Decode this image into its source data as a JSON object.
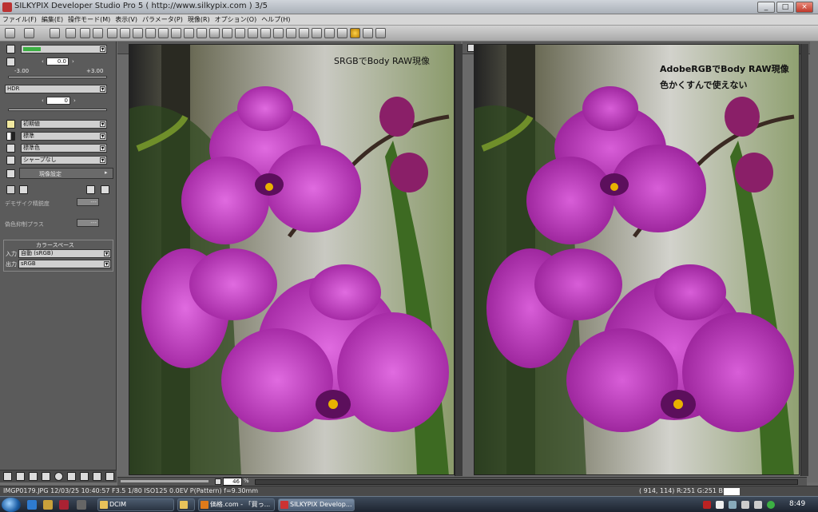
{
  "window": {
    "title": "SILKYPIX Developer Studio Pro 5 ( http://www.silkypix.com )   3/5",
    "buttons": [
      "_",
      "□",
      "×"
    ]
  },
  "menu": [
    "ファイル(F)",
    "編集(E)",
    "操作モード(M)",
    "表示(V)",
    "パラメータ(P)",
    "現像(R)",
    "オプション(O)",
    "ヘルプ(H)"
  ],
  "left": {
    "exposure_value": "0.0",
    "exposure_min": "-3.00",
    "exposure_max": "+3.00",
    "hdr_label": "HDR",
    "hdr_value": "0",
    "presets": [
      "初期値",
      "標準",
      "標準色",
      "シャープなし"
    ],
    "dev_settings_label": "現像設定",
    "demosaic_label": "デモザイク精鋭度",
    "demosaic_value": "---",
    "false_color_label": "偽色抑制プラス",
    "false_color_value": "---",
    "colorspace_header": "カラースペース",
    "input_label": "入力",
    "input_value": "自動 (sRGB)",
    "output_label": "出力",
    "output_value": "sRGB"
  },
  "viewer": {
    "left_caption": "SRGBでBody RAW現像",
    "right_caption_1": "AdobeRGBでBody RAW現像",
    "right_caption_2": "色かくすんで使えない",
    "zoom": "46"
  },
  "status": {
    "left": "IMGP0179.JPG 12/03/25 10:40:57 F3.5 1/80 ISO125  0.0EV P(Pattern) f=9.30mm",
    "right": "( 914, 114) R:251 G:251 B:251"
  },
  "taskbar": {
    "items": [
      "DCIM",
      "",
      "価格.com - 「買っ...",
      "SILKYPIX Develop..."
    ],
    "time": "8:49"
  },
  "colors": {
    "accent_green": "#3cb043",
    "panel": "#5b5b5b"
  }
}
